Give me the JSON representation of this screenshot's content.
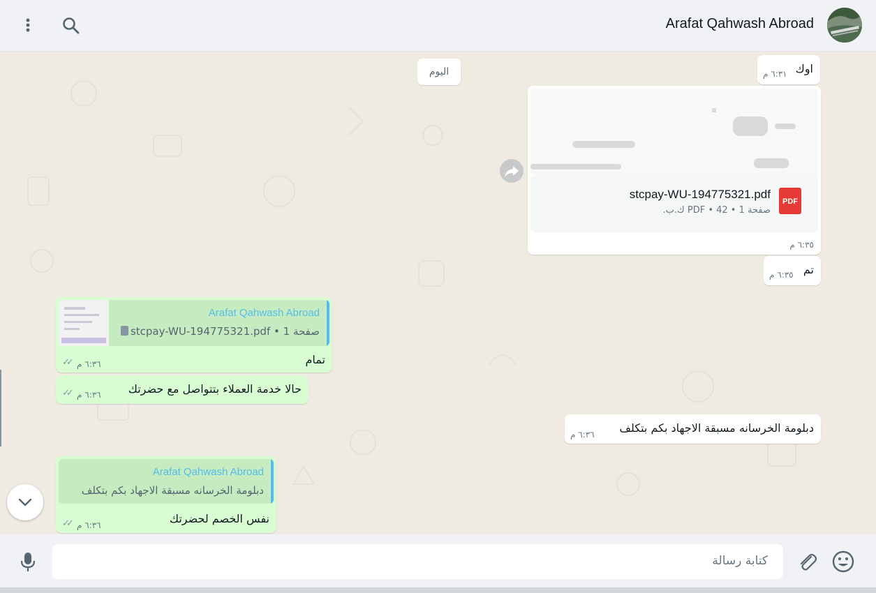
{
  "header": {
    "contact_name": "Arafat Qahwash Abroad",
    "icons": [
      "menu-icon",
      "search-icon"
    ]
  },
  "chat": {
    "day_chip": "اليوم",
    "messages": [
      {
        "dir": "out",
        "text": "اوك",
        "time": "٦:٣١ م"
      },
      {
        "dir": "out",
        "type": "document",
        "file_name": "stcpay-WU-194775321.pdf",
        "meta": "صفحة 1 • PDF • 42 ك.ب.",
        "badge": "PDF",
        "time": "٦:٣٥ م"
      },
      {
        "dir": "out",
        "text": "تم",
        "time": "٦:٣٥ م"
      },
      {
        "dir": "in",
        "quote_name": "Arafat Qahwash Abroad",
        "quote_text": "صفحة 1 • stcpay-WU-194775321.pdf",
        "text": "تمام",
        "time": "٦:٣٦ م"
      },
      {
        "dir": "in",
        "text": "حالا خدمة العملاء بتتواصل مع حضرتك",
        "time": "٦:٣٦ م"
      },
      {
        "dir": "out",
        "text": "دبلومة الخرسانه مسبقة الاجهاد بكم بتكلف",
        "time": "٦:٣٦ م"
      },
      {
        "dir": "in",
        "quote_name": "Arafat Qahwash Abroad",
        "quote_text": "دبلومة الخرسانه مسبقة الاجهاد بكم بتكلف",
        "text": "نفس الخصم لحضرتك",
        "time": "٦:٣٦ م"
      }
    ]
  },
  "composer": {
    "placeholder": "كتابة رسالة",
    "icons": [
      "mic-icon",
      "attach-icon",
      "emoji-icon"
    ]
  },
  "colors": {
    "incoming_bubble": "#d9fdd3",
    "outgoing_bubble": "#ffffff",
    "accent": "#53bdeb",
    "pdf_badge": "#e53935"
  }
}
